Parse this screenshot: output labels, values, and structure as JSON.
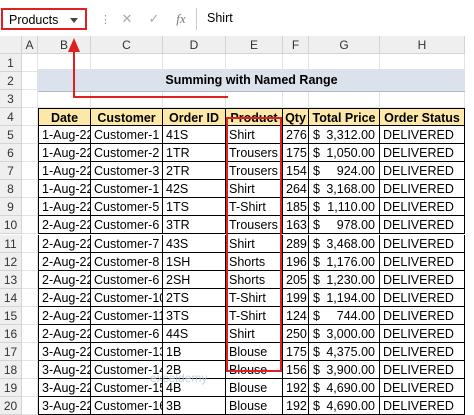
{
  "formula_bar": {
    "name_box": "Products",
    "separator": "⋮",
    "cancel_icon": "✕",
    "enter_icon": "✓",
    "fx_icon": "fx",
    "formula": "Shirt"
  },
  "columns": [
    "A",
    "B",
    "C",
    "D",
    "E",
    "F",
    "G",
    "H"
  ],
  "rows": [
    "1",
    "2",
    "3",
    "4",
    "5",
    "6",
    "7",
    "8",
    "9",
    "10",
    "11",
    "12",
    "13",
    "14",
    "15",
    "16",
    "17",
    "18",
    "19",
    "20"
  ],
  "title": "Summing with Named Range",
  "table": {
    "headers": [
      "Date",
      "Customer",
      "Order ID",
      "Product",
      "Qty",
      "Total Price",
      "Order Status"
    ],
    "rows": [
      [
        "1-Aug-22",
        "Customer-1",
        "41S",
        "Shirt",
        "276",
        "$",
        "3,312.00",
        "DELIVERED"
      ],
      [
        "1-Aug-22",
        "Customer-2",
        "1TR",
        "Trousers",
        "175",
        "$",
        "1,050.00",
        "DELIVERED"
      ],
      [
        "1-Aug-22",
        "Customer-3",
        "2TR",
        "Trousers",
        "154",
        "$",
        "924.00",
        "DELIVERED"
      ],
      [
        "1-Aug-22",
        "Customer-1",
        "42S",
        "Shirt",
        "264",
        "$",
        "3,168.00",
        "DELIVERED"
      ],
      [
        "1-Aug-22",
        "Customer-5",
        "1TS",
        "T-Shirt",
        "185",
        "$",
        "1,110.00",
        "DELIVERED"
      ],
      [
        "2-Aug-22",
        "Customer-6",
        "3TR",
        "Trousers",
        "163",
        "$",
        "978.00",
        "DELIVERED"
      ],
      [
        "2-Aug-22",
        "Customer-7",
        "43S",
        "Shirt",
        "289",
        "$",
        "3,468.00",
        "DELIVERED"
      ],
      [
        "2-Aug-22",
        "Customer-8",
        "1SH",
        "Shorts",
        "196",
        "$",
        "1,176.00",
        "DELIVERED"
      ],
      [
        "2-Aug-22",
        "Customer-6",
        "2SH",
        "Shorts",
        "205",
        "$",
        "1,230.00",
        "DELIVERED"
      ],
      [
        "2-Aug-22",
        "Customer-10",
        "2TS",
        "T-Shirt",
        "199",
        "$",
        "1,194.00",
        "DELIVERED"
      ],
      [
        "2-Aug-22",
        "Customer-11",
        "3TS",
        "T-Shirt",
        "124",
        "$",
        "744.00",
        "DELIVERED"
      ],
      [
        "2-Aug-22",
        "Customer-6",
        "44S",
        "Shirt",
        "250",
        "$",
        "3,000.00",
        "DELIVERED"
      ],
      [
        "3-Aug-22",
        "Customer-13",
        "1B",
        "Blouse",
        "175",
        "$",
        "4,375.00",
        "DELIVERED"
      ],
      [
        "3-Aug-22",
        "Customer-14",
        "2B",
        "Blouse",
        "156",
        "$",
        "3,900.00",
        "DELIVERED"
      ],
      [
        "3-Aug-22",
        "Customer-15",
        "4B",
        "Blouse",
        "192",
        "$",
        "4,690.00",
        "DELIVERED"
      ],
      [
        "3-Aug-22",
        "Customer-16",
        "3B",
        "Blouse",
        "192",
        "$",
        "4,690.00",
        "DELIVERED"
      ]
    ]
  },
  "watermark": "exceldemy"
}
